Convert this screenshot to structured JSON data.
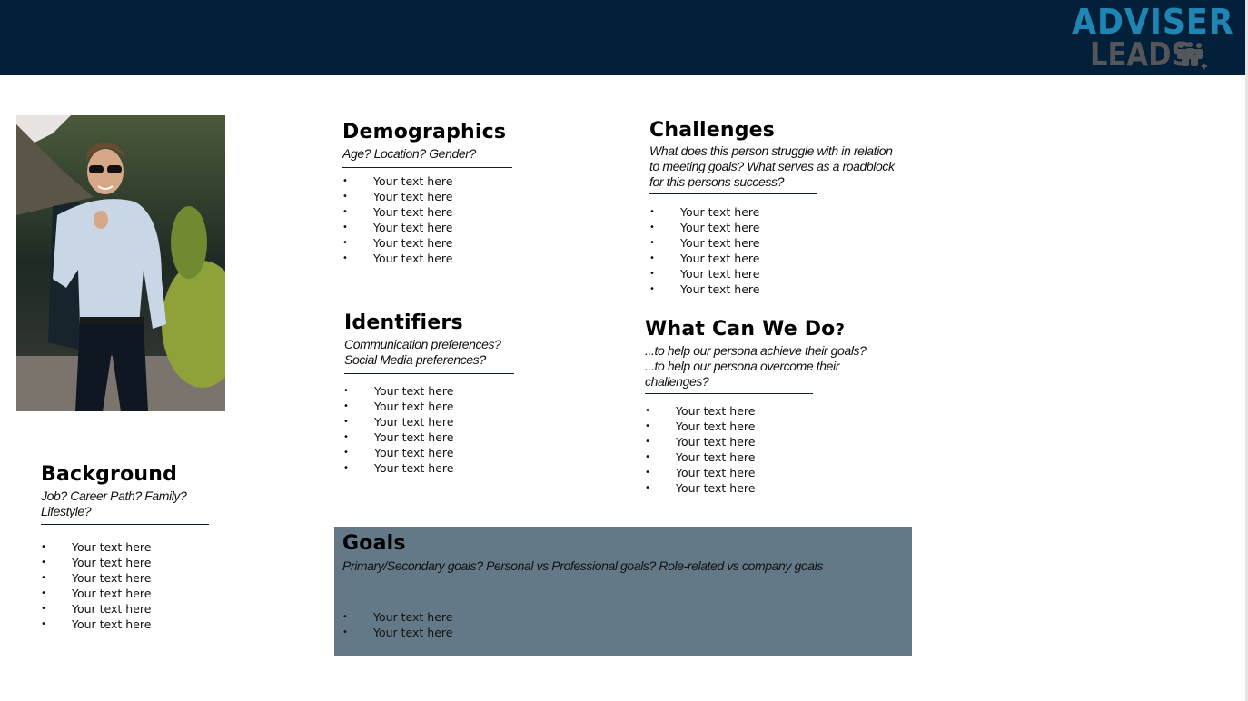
{
  "header": {
    "logo": {
      "line1": "ADVISER",
      "line2": "LEADS",
      "icon": "people-group-icon"
    },
    "colors": {
      "background": "#02203a",
      "logo_blue": "#1f86b3",
      "logo_gray": "#55565a"
    }
  },
  "photo": {
    "description": "Smiling man in sunglasses, light blue shirt and dark trousers, holding jacket over shoulder, outdoor garden"
  },
  "sections": {
    "demographics": {
      "title": "Demographics",
      "subtitle": "Age? Location? Gender?",
      "items": [
        "Your text here",
        "Your text here",
        "Your text here",
        "Your text here",
        "Your text here",
        "Your text here"
      ]
    },
    "identifiers": {
      "title": "Identifiers",
      "subtitle_lines": [
        "Communication preferences?",
        "Social Media preferences?"
      ],
      "items": [
        "Your text here",
        "Your text here",
        "Your text here",
        "Your text here",
        "Your text here",
        "Your text here"
      ]
    },
    "challenges": {
      "title": "Challenges",
      "subtitle_lines": [
        "What does this person struggle with in relation",
        "to meeting goals? What serves as a roadblock",
        "for this persons success?"
      ],
      "items": [
        "Your text here",
        "Your text here",
        "Your text here",
        "Your text here",
        "Your text here",
        "Your text here"
      ]
    },
    "what_can_we_do": {
      "title": "What Can We Do",
      "title_suffix": "?",
      "subtitle_lines": [
        "...to help our persona achieve their goals?",
        "...to help our persona overcome their",
        "challenges?"
      ],
      "items": [
        "Your text here",
        "Your text here",
        "Your text here",
        "Your text here",
        "Your text here",
        "Your text here"
      ]
    },
    "background": {
      "title": "Background",
      "subtitle_lines": [
        "Job? Career Path? Family?",
        "Lifestyle?"
      ],
      "items": [
        "Your text here",
        "Your text here",
        "Your text here",
        "Your text here",
        "Your text here",
        "Your text here"
      ]
    },
    "goals": {
      "title": "Goals",
      "subtitle": "Primary/Secondary goals? Personal vs Professional goals? Role-related vs company goals",
      "items": [
        "Your text here",
        "Your text here"
      ],
      "box_color": "#647987"
    }
  },
  "bullet": "•"
}
